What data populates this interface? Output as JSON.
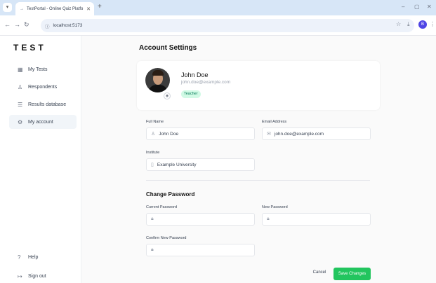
{
  "browser": {
    "tab_title": "TestPortal - Online Quiz Platfo",
    "url": "localhost:5173",
    "profile_initial": "B"
  },
  "sidebar": {
    "logo": "TEST",
    "items": [
      {
        "label": "My Tests",
        "icon": "grid-icon"
      },
      {
        "label": "Respondents",
        "icon": "users-icon"
      },
      {
        "label": "Results database",
        "icon": "database-icon"
      },
      {
        "label": "My account",
        "icon": "gear-icon",
        "active": true
      }
    ],
    "bottom_items": [
      {
        "label": "Help",
        "icon": "help-icon"
      },
      {
        "label": "Sign out",
        "icon": "sign-out-icon"
      }
    ]
  },
  "main": {
    "title": "Account Settings",
    "profile": {
      "name": "John Doe",
      "email": "john.doe@example.com",
      "role": "Teacher"
    },
    "form": {
      "full_name_label": "Full Name",
      "full_name_value": "John Doe",
      "email_label": "Email Address",
      "email_value": "john.doe@example.com",
      "institute_label": "Institute",
      "institute_value": "Example University"
    },
    "password": {
      "title": "Change Password",
      "current_label": "Current Password",
      "new_label": "New Password",
      "confirm_label": "Confirm New Password"
    },
    "actions": {
      "cancel": "Cancel",
      "save": "Save Changes"
    }
  },
  "colors": {
    "accent": "#22c55e",
    "badge_bg": "#d1fae5",
    "badge_text": "#047857",
    "tabstrip": "#d7e6f7"
  }
}
